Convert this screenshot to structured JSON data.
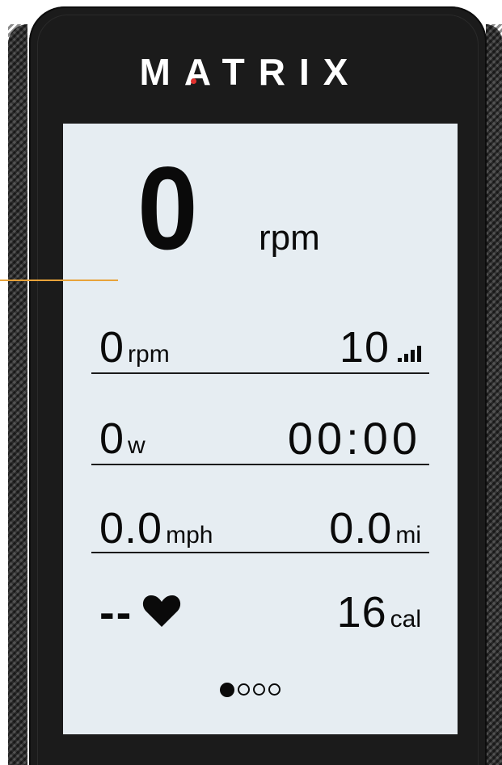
{
  "brand": {
    "name": "MATRIX",
    "accent_color": "#e0312e"
  },
  "main_metric": {
    "value": "0",
    "unit": "rpm"
  },
  "rows": [
    {
      "left": {
        "value": "0",
        "unit": "rpm"
      },
      "right": {
        "value": "10",
        "icon": "signal-bars-icon"
      }
    },
    {
      "left": {
        "value": "0",
        "unit": "w"
      },
      "right": {
        "value": "00:00"
      }
    },
    {
      "left": {
        "value": "0.0",
        "unit": "mph"
      },
      "right": {
        "value": "0.0",
        "unit": "mi"
      }
    },
    {
      "left": {
        "value": "--",
        "icon": "heart-icon"
      },
      "right": {
        "value": "16",
        "unit": "cal"
      }
    }
  ],
  "pagination": {
    "total_pages": 4,
    "current_page": 1
  },
  "colors": {
    "screen_background": "#e6edf2",
    "bezel": "#1b1b1b",
    "pointer_line": "#e8a33a"
  }
}
